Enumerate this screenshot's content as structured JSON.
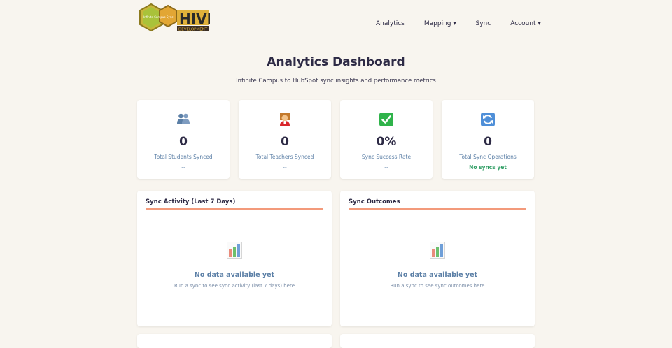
{
  "nav": {
    "logo": {
      "main_text": "HIVE",
      "sub_text": "DEVELOPMENT",
      "badge_text": "Infinite Campus Sync"
    },
    "items": [
      {
        "label": "Analytics",
        "dropdown": false
      },
      {
        "label": "Mapping",
        "dropdown": true
      },
      {
        "label": "Sync",
        "dropdown": false
      },
      {
        "label": "Account",
        "dropdown": true
      }
    ]
  },
  "header": {
    "title": "Analytics Dashboard",
    "subtitle": "Infinite Campus to HubSpot sync insights and performance metrics"
  },
  "stats": [
    {
      "icon": "students-icon",
      "value": "0",
      "label": "Total Students Synced",
      "sub": "--"
    },
    {
      "icon": "teacher-icon",
      "value": "0",
      "label": "Total Teachers Synced",
      "sub": "--"
    },
    {
      "icon": "check-icon",
      "value": "0%",
      "label": "Sync Success Rate",
      "sub": "--"
    },
    {
      "icon": "refresh-icon",
      "value": "0",
      "label": "Total Sync Operations",
      "sub": "No syncs yet"
    }
  ],
  "panels": [
    {
      "title": "Sync Activity (Last 7 Days)",
      "empty": "No data available yet",
      "hint": "Run a sync to see sync activity (last 7 days) here"
    },
    {
      "title": "Sync Outcomes",
      "empty": "No data available yet",
      "hint": "Run a sync to see sync outcomes here"
    }
  ],
  "colors": {
    "background": "#f8f5ef",
    "accent": "#f39a7b",
    "label": "#5b7fa6",
    "success": "#2e9d63",
    "heading": "#2d2a45"
  }
}
